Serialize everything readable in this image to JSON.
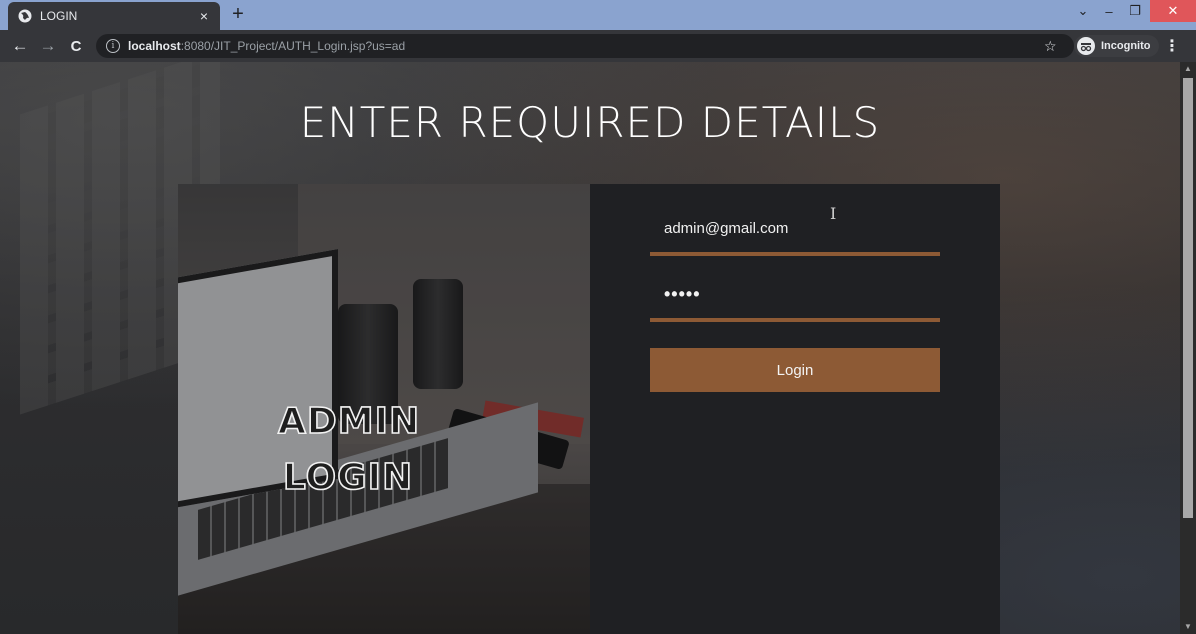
{
  "browser": {
    "tab_title": "LOGIN",
    "tab_close": "×",
    "new_tab": "+",
    "url_host": "localhost",
    "url_path": ":8080/JIT_Project/AUTH_Login.jsp?us=ad",
    "incognito_label": "Incognito",
    "icons": [
      "globe-icon",
      "back-arrow-icon",
      "forward-arrow-icon",
      "reload-icon",
      "info-icon",
      "star-icon",
      "incognito-icon",
      "kebab-menu-icon"
    ]
  },
  "page": {
    "heading": "ENTER REQUIRED DETAILS",
    "panel_title_line1": "ADMIN",
    "panel_title_line2": "LOGIN",
    "email_value": "admin@gmail.com",
    "password_value": "•••••",
    "login_label": "Login"
  },
  "colors": {
    "accent": "#8d5a35",
    "form_bg": "#1f2023",
    "tabstrip": "#8aa3cf"
  }
}
